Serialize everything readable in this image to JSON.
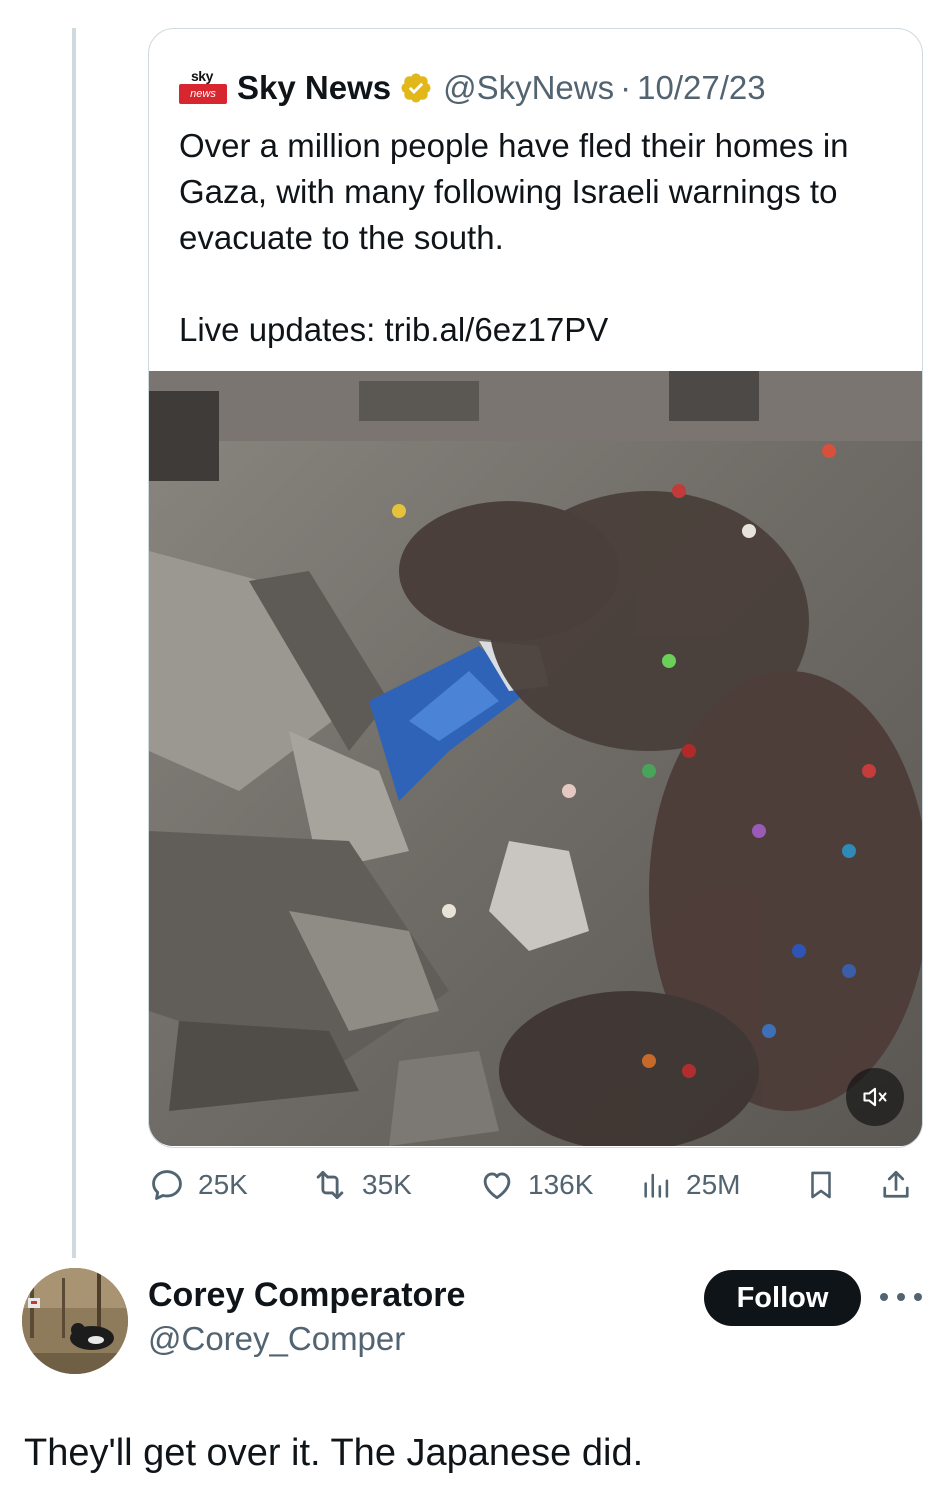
{
  "quoted_tweet": {
    "logo_top": "sky",
    "logo_bottom": "news",
    "author_name": "Sky News",
    "handle": "@SkyNews",
    "separator": "·",
    "date": "10/27/23",
    "text": "Over a million people have fled their homes in Gaza, with many following Israeli warnings to evacuate to the south.",
    "link_line": "Live updates: trib.al/6ez17PV",
    "media": {
      "description_icon": "mute-icon"
    },
    "stats": {
      "replies": "25K",
      "reposts": "35K",
      "likes": "136K",
      "views": "25M"
    }
  },
  "reply": {
    "author_name": "Corey Comperatore",
    "handle": "@Corey_Comper",
    "follow_label": "Follow",
    "text": "They'll get over it. The Japanese did."
  },
  "colors": {
    "text_primary": "#0f1419",
    "text_secondary": "#536471",
    "border": "#cfd9de",
    "verified_gold": "#e2b719",
    "follow_bg": "#0f1419",
    "sky_red": "#d7262f"
  }
}
